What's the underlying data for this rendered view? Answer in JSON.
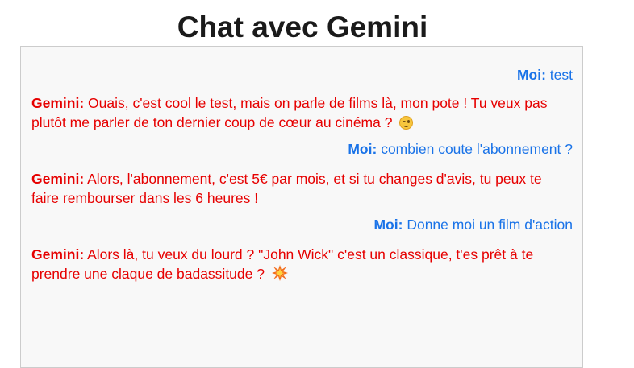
{
  "page": {
    "title": "Chat avec Gemini"
  },
  "chat": {
    "messages": [
      {
        "sender": "Moi:",
        "text": "test",
        "role": "user"
      },
      {
        "sender": "Gemini:",
        "text": "Ouais, c'est cool le test, mais on parle de films là, mon pote ! Tu veux pas plutôt me parler de ton dernier coup de cœur au cinéma ?",
        "role": "bot",
        "emoji": "winking-face-icon"
      },
      {
        "sender": "Moi:",
        "text": "combien coute l'abonnement ?",
        "role": "user"
      },
      {
        "sender": "Gemini:",
        "text": "Alors, l'abonnement, c'est 5€ par mois, et si tu changes d'avis, tu peux te faire rembourser dans les 6 heures !",
        "role": "bot"
      },
      {
        "sender": "Moi:",
        "text": "Donne moi un film d'action",
        "role": "user"
      },
      {
        "sender": "Gemini:",
        "text": "Alors là, tu veux du lourd ? \"John Wick\" c'est un classique, t'es prêt à te prendre une claque de badassitude ?",
        "role": "bot",
        "emoji": "collision-icon"
      }
    ]
  },
  "colors": {
    "user": "#1a73e8",
    "bot": "#e60000",
    "chat_background": "#f8f8f8"
  }
}
